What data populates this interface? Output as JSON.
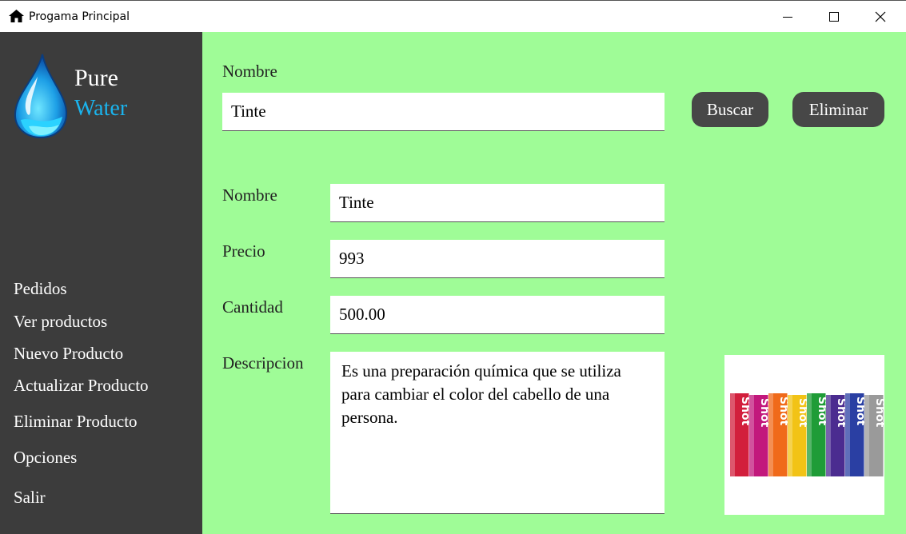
{
  "window": {
    "title": "Progama Principal",
    "home_icon": "home-icon",
    "controls": [
      "minimize-icon",
      "maximize-icon",
      "close-icon"
    ]
  },
  "sidebar": {
    "logo": {
      "line1": "Pure",
      "line2": "Water",
      "icon": "water-drop-icon",
      "accent": "#1ab4ee"
    },
    "items": [
      {
        "label": "Pedidos"
      },
      {
        "label": "Ver productos"
      },
      {
        "label": "Nuevo Producto"
      },
      {
        "label": "Actualizar Producto"
      },
      {
        "label": "Eliminar Producto"
      },
      {
        "label": "Opciones"
      },
      {
        "label": "Salir"
      }
    ]
  },
  "search": {
    "label": "Nombre",
    "value": "Tinte",
    "buscar_label": "Buscar",
    "eliminar_label": "Eliminar"
  },
  "form": {
    "nombre_label": "Nombre",
    "nombre_value": "Tinte",
    "precio_label": "Precio",
    "precio_value": "993",
    "cantidad_label": "Cantidad",
    "cantidad_value": "500.00",
    "descripcion_label": "Descripcion",
    "descripcion_value": "Es una preparación química que se utiliza para cambiar el color del cabello de una persona."
  },
  "product_image": {
    "brand_text": "Shot",
    "box_colors": [
      "#d21f3c",
      "#c2187c",
      "#f06a1a",
      "#f2c316",
      "#1f9c37",
      "#4b2c90",
      "#2a3fa3",
      "#9a9a9a"
    ]
  },
  "colors": {
    "main_bg": "#9ffc97",
    "sidebar_bg": "#3c3c3c",
    "button_bg": "#474747"
  }
}
